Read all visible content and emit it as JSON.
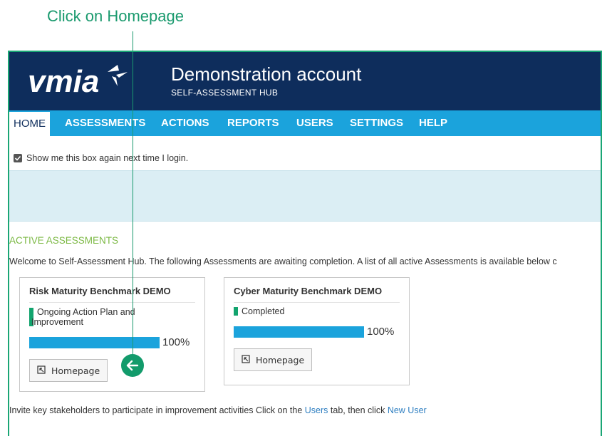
{
  "callout": {
    "text": "Click on Homepage",
    "arrow_icon": "arrow-left-icon",
    "color": "#1a9a6e"
  },
  "header": {
    "logo_text": "vmia",
    "account_title": "Demonstration account",
    "subtitle": "SELF-ASSESSMENT HUB",
    "background": "#0e2d5c"
  },
  "nav": {
    "background": "#1ba3dc",
    "items": [
      {
        "label": "HOME",
        "active": true
      },
      {
        "label": "ASSESSMENTS",
        "active": false
      },
      {
        "label": "ACTIONS",
        "active": false
      },
      {
        "label": "REPORTS",
        "active": false
      },
      {
        "label": "USERS",
        "active": false
      },
      {
        "label": "SETTINGS",
        "active": false
      },
      {
        "label": "HELP",
        "active": false
      }
    ]
  },
  "show_box": {
    "label": "Show me this box again next time I login.",
    "checked": true
  },
  "active_assessments": {
    "heading": "ACTIVE ASSESSMENTS",
    "welcome": "Welcome to Self-Assessment Hub. The following Assessments are awaiting completion. A list of all active Assessments is available below c",
    "cards": [
      {
        "title": "Risk Maturity Benchmark DEMO",
        "status_line1": "Ongoing Action Plan and",
        "status_line2": "Improvement",
        "progress_percent": 100,
        "progress_label": "100%",
        "button_label": "Homepage"
      },
      {
        "title": "Cyber Maturity Benchmark DEMO",
        "status_line1": "Completed",
        "progress_percent": 100,
        "progress_label": "100%",
        "button_label": "Homepage"
      }
    ]
  },
  "invite": {
    "prefix": "Invite key stakeholders to participate in improvement activities Click on the ",
    "users_link": "Users",
    "middle": " tab, then click ",
    "new_user_link": "New User"
  },
  "colors": {
    "accent_green": "#12a46e",
    "progress_blue": "#1ba3dc",
    "heading_green": "#7bb843",
    "link_blue": "#2f7fc1"
  }
}
